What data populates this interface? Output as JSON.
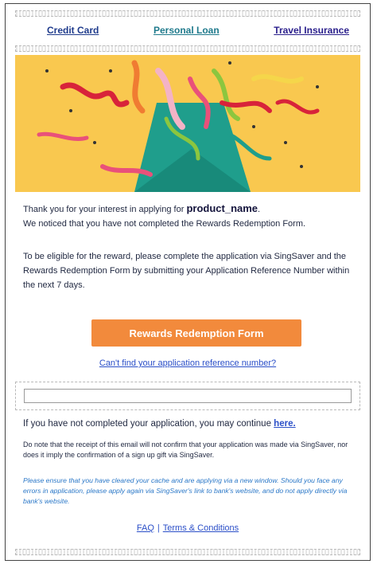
{
  "nav": {
    "credit_card": "Credit Card",
    "personal_loan": "Personal Loan",
    "travel_insurance": "Travel Insurance"
  },
  "body": {
    "intro_prefix": "Thank you for your interest in applying for ",
    "product_name": "product_name",
    "intro_suffix": ".",
    "intro_line2": "We noticed that you have not completed the Rewards Redemption Form.",
    "eligibility": "To be eligible for the reward, please complete the application via SingSaver and the Rewards Redemption Form by submitting your Application Reference Number within the next 7 days.",
    "cta_label": "Rewards Redemption Form",
    "ref_link": "Can't find your application reference number?",
    "continue_prefix": "If you have not completed your application, you may continue ",
    "continue_link": "here.",
    "disclaimer": "Do note that the receipt of this email will not confirm that your application was made via SingSaver, nor does it imply the confirmation of a sign up gift via SingSaver.",
    "cache_note": "Please ensure that you have cleared your cache and are applying via a new window. Should you face any errors in application, please apply again via SingSaver's link to bank's website, and do not apply directly via bank's website."
  },
  "footer": {
    "faq": "FAQ",
    "separator": "|",
    "terms": "Terms & Conditions"
  },
  "colors": {
    "hero_bg": "#f9c84f",
    "cta_bg": "#f28a3c",
    "link": "#2b4fc8"
  }
}
